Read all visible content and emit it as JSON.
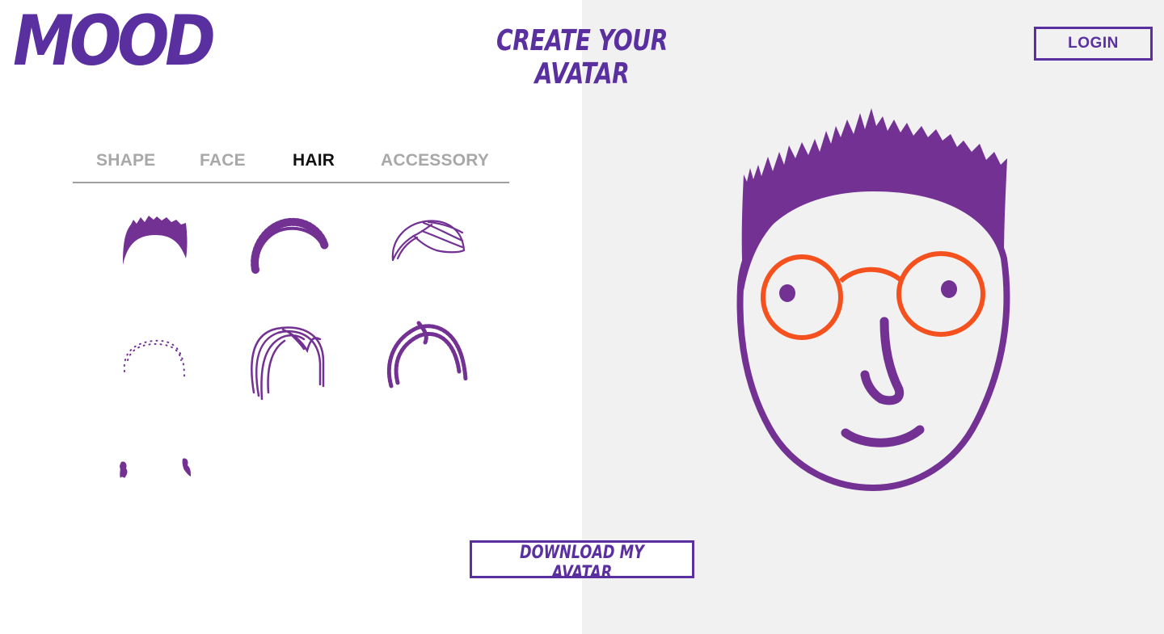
{
  "header": {
    "logo_text": "MOOD",
    "title": "CREATE YOUR AVATAR",
    "login_label": "LOGIN"
  },
  "tabs": [
    {
      "label": "SHAPE",
      "active": false
    },
    {
      "label": "FACE",
      "active": false
    },
    {
      "label": "HAIR",
      "active": true
    },
    {
      "label": "ACCESSORY",
      "active": false
    }
  ],
  "hair_options": [
    {
      "icon": "short-spiky-hair-icon"
    },
    {
      "icon": "curly-fringe-hair-icon"
    },
    {
      "icon": "swept-lines-hair-icon"
    },
    {
      "icon": "dotted-buzz-hair-icon"
    },
    {
      "icon": "long-straight-hair-icon"
    },
    {
      "icon": "curly-bushy-hair-icon"
    },
    {
      "icon": "sideburns-hair-icon"
    }
  ],
  "download_label": "DOWNLOAD MY AVATAR",
  "avatar": {
    "face_shape": "oval",
    "hair": "short-spiky",
    "accessory": "round-glasses"
  },
  "colors": {
    "brand": "#5a2fa0",
    "hair": "#723193",
    "glasses": "#f4511e",
    "panel_background": "#f1f1f1",
    "tab_inactive": "#a8a8a8",
    "tab_active": "#111111"
  }
}
